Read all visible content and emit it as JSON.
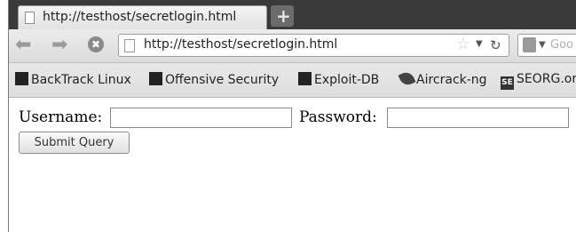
{
  "tab": {
    "title": "http://testhost/secretlogin.html",
    "new_tab_symbol": "+"
  },
  "navbar": {
    "url": "http://testhost/secretlogin.html",
    "search_placeholder": "Goo",
    "icons": [
      "back-arrow-icon",
      "forward-arrow-icon",
      "stop-icon",
      "bookmark-star-icon",
      "reload-icon",
      "search-engine-icon"
    ]
  },
  "bookmarks": [
    {
      "label": "BackTrack Linux"
    },
    {
      "label": "Offensive Security"
    },
    {
      "label": "Exploit-DB"
    },
    {
      "label": "Aircrack-ng"
    },
    {
      "label": "SEORG.or"
    }
  ],
  "form": {
    "username_label": "Username:",
    "password_label": "Password:",
    "username_value": "",
    "password_value": "",
    "submit_label": "Submit Query"
  }
}
